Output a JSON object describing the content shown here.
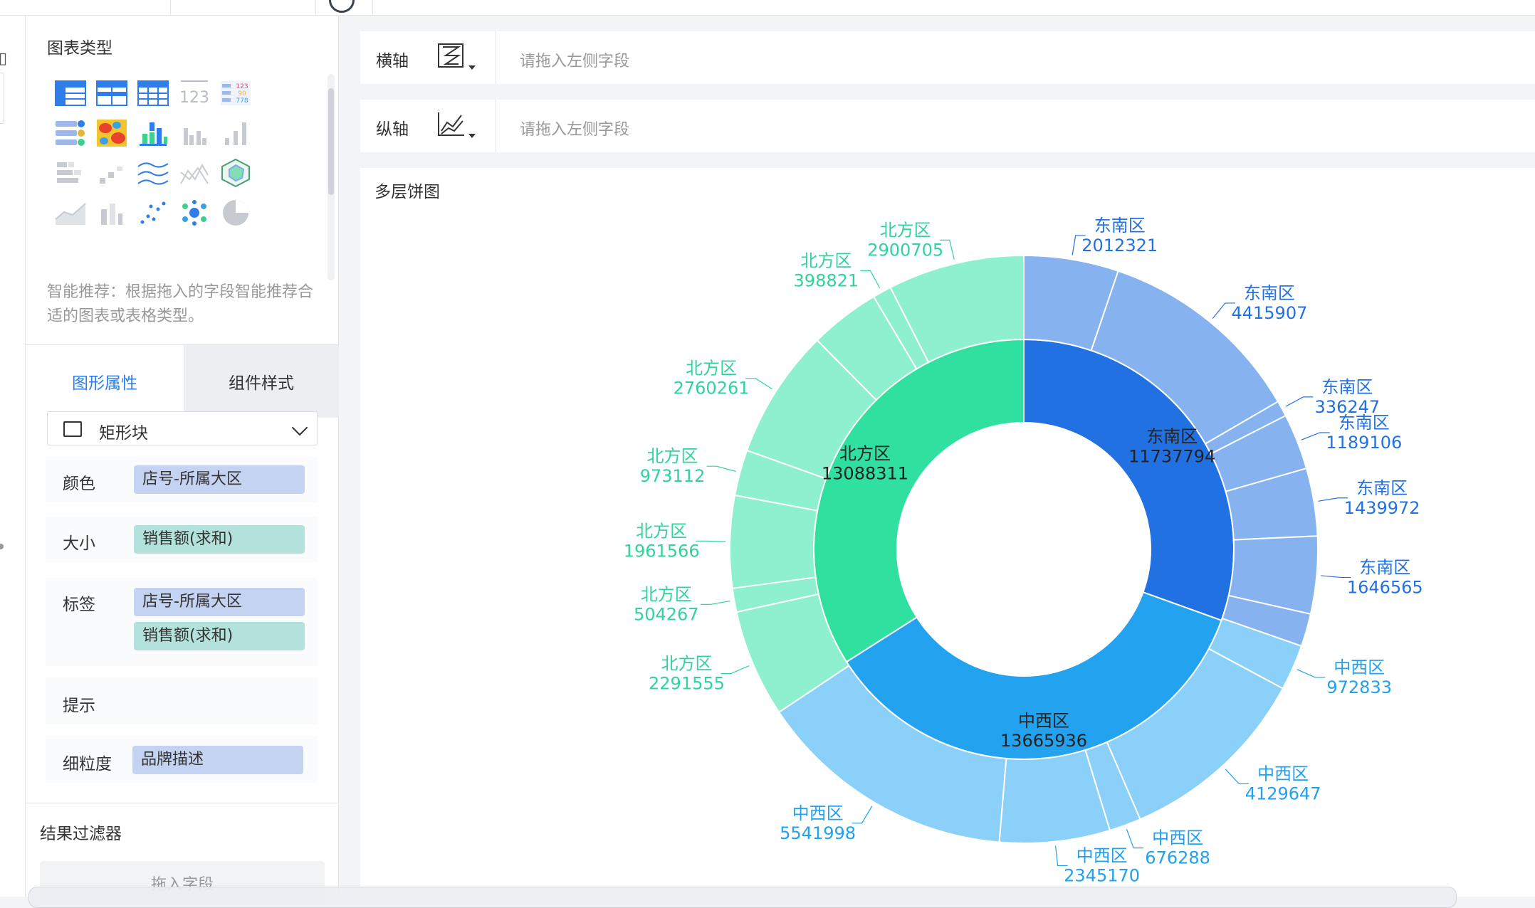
{
  "panel": {
    "chart_type_title": "图表类型",
    "hint": "智能推荐：根据拖入的字段智能推荐合适的图表或表格类型。",
    "tabs": [
      "图形属性",
      "组件样式"
    ],
    "shape_select": "矩形块",
    "props": {
      "color": {
        "label": "颜色",
        "field": "店号-所属大区"
      },
      "size": {
        "label": "大小",
        "field": "销售额(求和)"
      },
      "label": {
        "label": "标签",
        "fields": [
          "店号-所属大区",
          "销售额(求和)"
        ]
      },
      "tooltip": {
        "label": "提示"
      },
      "granularity": {
        "label": "细粒度",
        "field": "品牌描述"
      }
    },
    "filter_title": "结果过滤器",
    "filter_drop": "拖入字段"
  },
  "axes": {
    "x": {
      "label": "横轴",
      "placeholder": "请拖入左侧字段"
    },
    "y": {
      "label": "纵轴",
      "placeholder": "请拖入左侧字段"
    }
  },
  "chart_title": "多层饼图",
  "colors": {
    "accent": "#2f7dea",
    "southeast_inner": "#2271e3",
    "southeast_outer": "#86b2ef",
    "southeast_text": "#2271e3",
    "midwest_inner": "#23a3ef",
    "midwest_outer": "#8bd0f8",
    "midwest_text": "#21a0ee",
    "north_inner": "#30e09f",
    "north_outer": "#8ef0cf",
    "north_text": "#2fd498"
  },
  "chart_data": {
    "type": "pie",
    "inner": [
      {
        "name": "东南区",
        "value": 11737794
      },
      {
        "name": "中西区",
        "value": 13665936
      },
      {
        "name": "北方区",
        "value": 13088311
      }
    ],
    "outer": [
      {
        "name": "东南区",
        "value": 2012321
      },
      {
        "name": "东南区",
        "value": 4415907
      },
      {
        "name": "东南区",
        "value": 336247
      },
      {
        "name": "东南区",
        "value": 1189106
      },
      {
        "name": "东南区",
        "value": 1439972
      },
      {
        "name": "东南区",
        "value": 1646565
      },
      {
        "name": "东南区",
        "value": 697676
      },
      {
        "name": "中西区",
        "value": 972833
      },
      {
        "name": "中西区",
        "value": 4129647
      },
      {
        "name": "中西区",
        "value": 676288
      },
      {
        "name": "中西区",
        "value": 2345170
      },
      {
        "name": "中西区",
        "value": 5541998
      },
      {
        "name": "北方区",
        "value": 2291555
      },
      {
        "name": "北方区",
        "value": 504267
      },
      {
        "name": "北方区",
        "value": 1961566
      },
      {
        "name": "北方区",
        "value": 973112
      },
      {
        "name": "北方区",
        "value": 2760261
      },
      {
        "name": "北方区",
        "value": 1498290
      },
      {
        "name": "北方区",
        "value": 398821
      },
      {
        "name": "北方区",
        "value": 2900705
      }
    ],
    "outer_labels": [
      {
        "name": "东南区",
        "value": "2012321"
      },
      {
        "name": "东南区",
        "value": "4415907"
      },
      {
        "name": "东南区",
        "value": "336247"
      },
      {
        "name": "东南区",
        "value": "1189106"
      },
      {
        "name": "东南区",
        "value": "1439972"
      },
      {
        "name": "东南区",
        "value": "1646565"
      },
      {
        "name": "中西区",
        "value": "972833"
      },
      {
        "name": "中西区",
        "value": "4129647"
      },
      {
        "name": "中西区",
        "value": "676288"
      },
      {
        "name": "中西区",
        "value": "2345170"
      },
      {
        "name": "中西区",
        "value": "5541998"
      },
      {
        "name": "北方区",
        "value": "2291555"
      },
      {
        "name": "北方区",
        "value": "504267"
      },
      {
        "name": "北方区",
        "value": "1961566"
      },
      {
        "name": "北方区",
        "value": "973112"
      },
      {
        "name": "北方区",
        "value": "2760261"
      },
      {
        "name": "北方区",
        "value": "398821"
      },
      {
        "name": "北方区",
        "value": "2900705"
      }
    ],
    "inner_labels": [
      {
        "name": "东南区",
        "value": "11737794"
      },
      {
        "name": "中西区",
        "value": "13665936"
      },
      {
        "name": "北方区",
        "value": "13088311"
      }
    ]
  }
}
